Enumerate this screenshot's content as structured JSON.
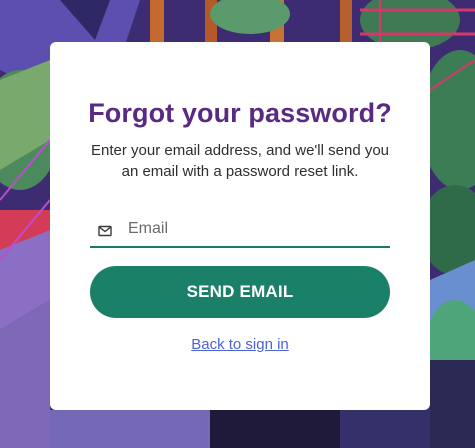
{
  "background": {
    "description_icon": "illustrated-jungle-background"
  },
  "form": {
    "title": "Forgot your password?",
    "description": "Enter your email address, and we'll send you an email with a password reset link.",
    "email": {
      "placeholder": "Email",
      "value": "",
      "icon": "mail-icon"
    },
    "send_button_label": "SEND EMAIL",
    "back_link_label": "Back to sign in"
  },
  "colors": {
    "title": "#5a2a83",
    "primary": "#1b8068",
    "link": "#4a63d6"
  }
}
